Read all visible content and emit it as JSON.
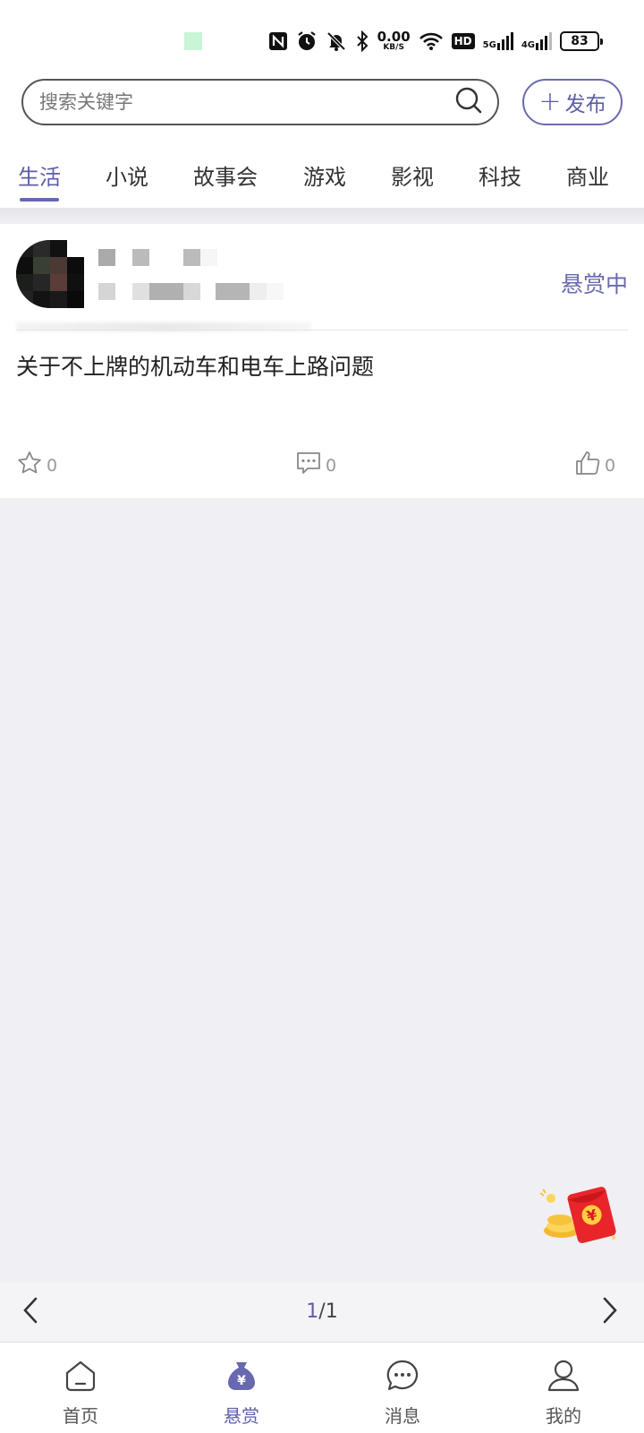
{
  "status_bar": {
    "net_speed_value": "0.00",
    "net_speed_unit": "KB/S",
    "hd_label": "HD",
    "sig1_label": "5G",
    "sig2_label": "4G",
    "battery": "83"
  },
  "header": {
    "search_placeholder": "搜索关键字",
    "publish_label": "发布"
  },
  "tabs": [
    "生活",
    "小说",
    "故事会",
    "游戏",
    "影视",
    "科技",
    "商业"
  ],
  "active_tab": "生活",
  "post": {
    "status": "悬赏中",
    "title": "关于不上牌的机动车和电车上路问题",
    "favorites": "0",
    "comments": "0",
    "likes": "0"
  },
  "pager": {
    "current": "1",
    "separator": "/",
    "total": "1"
  },
  "bottom_nav": [
    {
      "label": "首页",
      "icon": "home-icon"
    },
    {
      "label": "悬赏",
      "icon": "money-bag-icon"
    },
    {
      "label": "消息",
      "icon": "chat-icon"
    },
    {
      "label": "我的",
      "icon": "user-icon"
    }
  ],
  "colors": {
    "accent": "#5d5ea8",
    "background": "#efeff4"
  }
}
